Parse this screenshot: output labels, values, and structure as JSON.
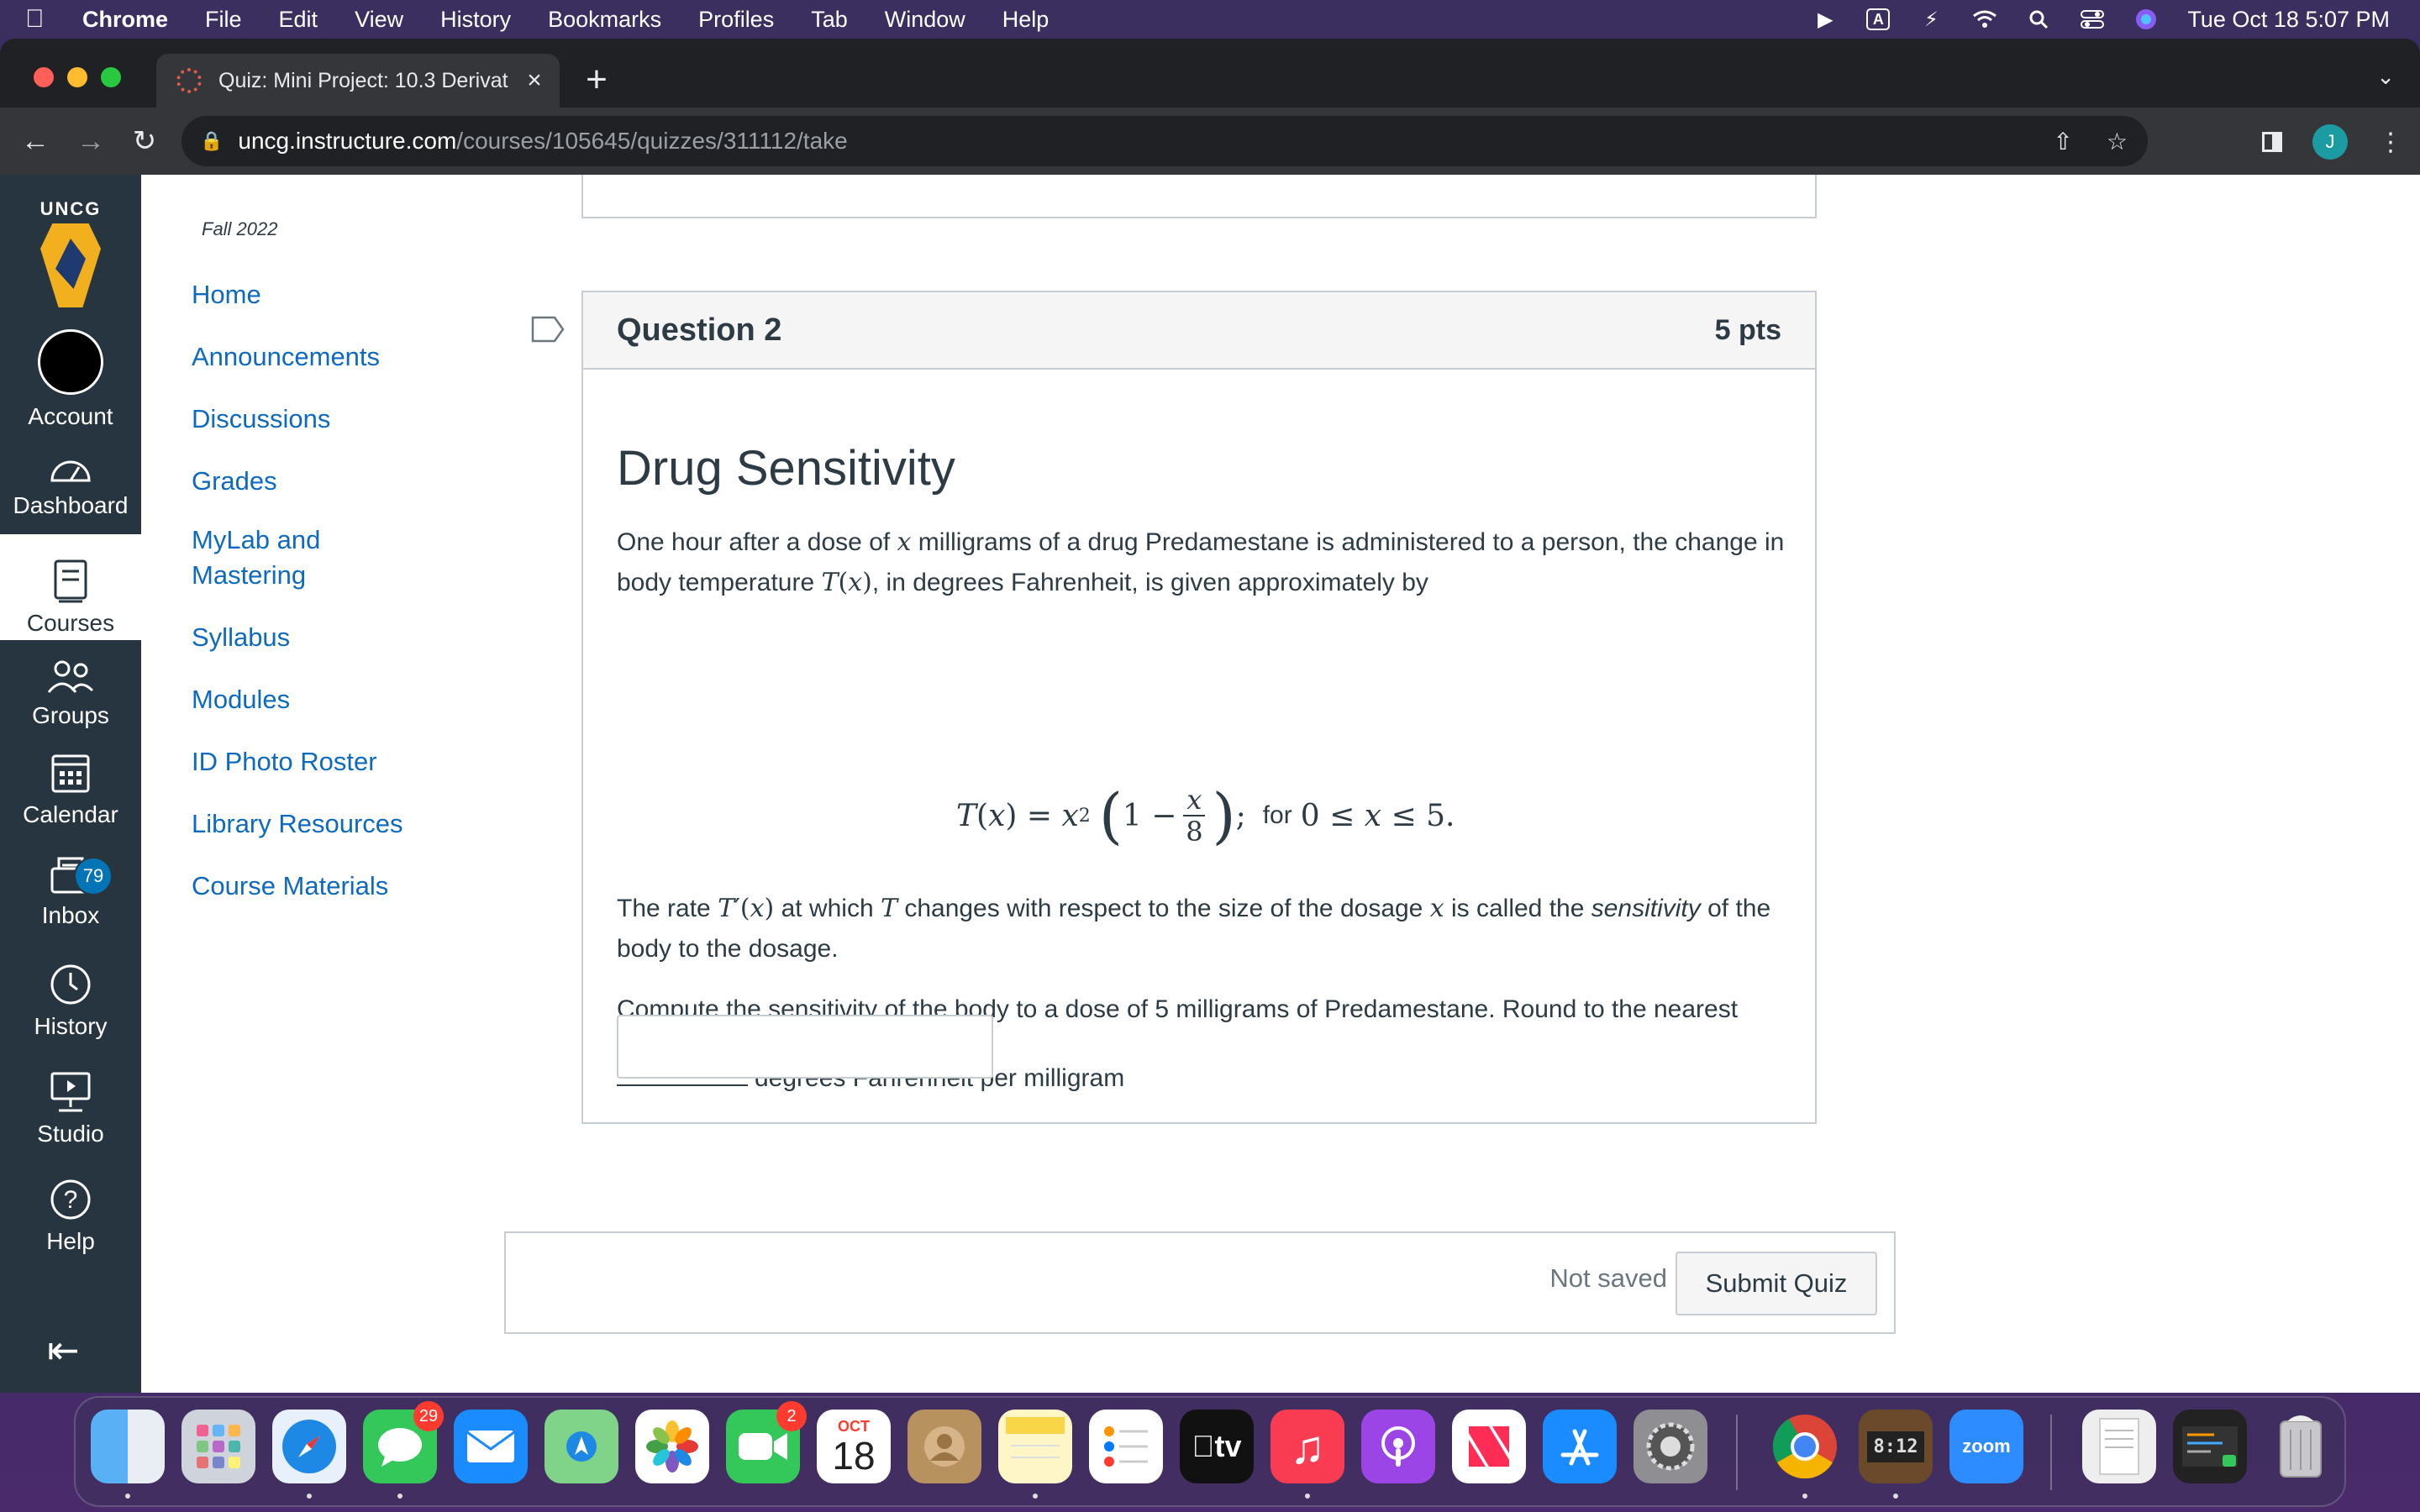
{
  "menubar": {
    "app": "Chrome",
    "items": [
      "File",
      "Edit",
      "View",
      "History",
      "Bookmarks",
      "Profiles",
      "Tab",
      "Window",
      "Help"
    ],
    "keyboard_indicator": "A",
    "clock": "Tue Oct 18  5:07 PM"
  },
  "browser": {
    "tab_title": "Quiz: Mini Project: 10.3 Derivat",
    "url_host": "uncg.instructure.com",
    "url_path": "/courses/105645/quizzes/311112/take",
    "profile_initial": "J"
  },
  "global_nav": {
    "logo_text": "UNCG",
    "items": [
      {
        "label": "Account"
      },
      {
        "label": "Dashboard"
      },
      {
        "label": "Courses"
      },
      {
        "label": "Groups"
      },
      {
        "label": "Calendar"
      },
      {
        "label": "Inbox",
        "badge": "79"
      },
      {
        "label": "History"
      },
      {
        "label": "Studio"
      },
      {
        "label": "Help"
      }
    ]
  },
  "course_nav": {
    "term": "Fall 2022",
    "links": [
      "Home",
      "Announcements",
      "Discussions",
      "Grades",
      "MyLab and Mastering",
      "Syllabus",
      "Modules",
      "ID Photo Roster",
      "Library Resources",
      "Course Materials"
    ]
  },
  "question": {
    "name": "Question 2",
    "points": "5 pts",
    "title": "Drug Sensitivity",
    "p1_a": "One hour after a dose of ",
    "p1_b": " milligrams of a drug Predamestane is administered to a person, the change in body temperature ",
    "p1_c": ", in degrees Fahrenheit, is given approximately by",
    "formula_suffix": "for",
    "p2_a": "The rate ",
    "p2_b": " at which ",
    "p2_c": " changes with respect to the size of the dosage ",
    "p2_d": " is called the ",
    "p2_em": "sensitivity",
    "p2_e": " of the body to the dosage.",
    "p3": "Compute the sensitivity of the body to a dose of 5 milligrams of Predamestane.  Round to the nearest hundredth (2 decimal places).",
    "answer_units": "degrees Fahrenheit per milligram",
    "answer_value": ""
  },
  "footer": {
    "status": "Not saved",
    "submit_label": "Submit Quiz"
  },
  "dock": {
    "messages_badge": "29",
    "facetime_badge": "2",
    "calendar_month": "OCT",
    "calendar_day": "18",
    "tv_label": "tv",
    "zoom_label": "zoom",
    "clock_display": "8:12"
  }
}
